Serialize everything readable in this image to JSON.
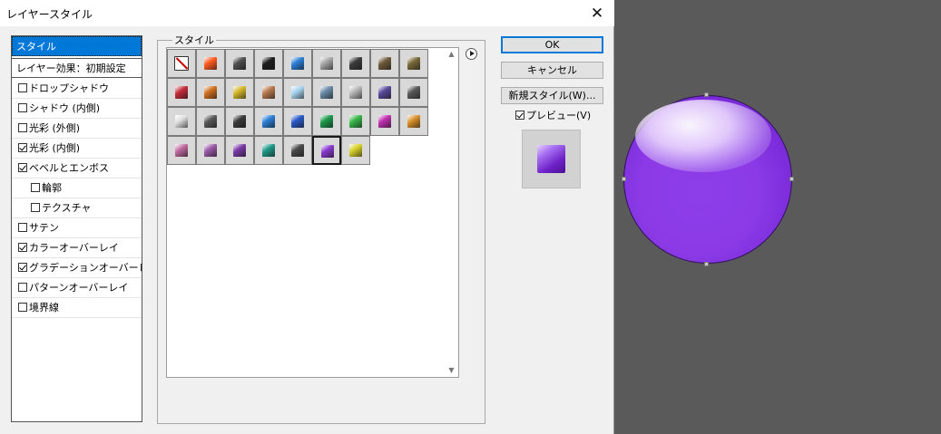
{
  "window": {
    "title": "レイヤースタイル",
    "close_symbol": "✕"
  },
  "sidebar": {
    "selected": "スタイル",
    "header": "レイヤー効果：初期設定",
    "items": [
      {
        "label": "ドロップシャドウ",
        "checked": false,
        "indent": false
      },
      {
        "label": "シャドウ (内側)",
        "checked": false,
        "indent": false
      },
      {
        "label": "光彩 (外側)",
        "checked": false,
        "indent": false
      },
      {
        "label": "光彩 (内側)",
        "checked": true,
        "indent": false
      },
      {
        "label": "ベベルとエンボス",
        "checked": true,
        "indent": false
      },
      {
        "label": "輪郭",
        "checked": false,
        "indent": true
      },
      {
        "label": "テクスチャ",
        "checked": false,
        "indent": true
      },
      {
        "label": "サテン",
        "checked": false,
        "indent": false
      },
      {
        "label": "カラーオーバーレイ",
        "checked": true,
        "indent": false
      },
      {
        "label": "グラデーションオーバーレイ",
        "checked": true,
        "indent": false
      },
      {
        "label": "パターンオーバーレイ",
        "checked": false,
        "indent": false
      },
      {
        "label": "境界線",
        "checked": false,
        "indent": false
      }
    ]
  },
  "styles": {
    "group_label": "スタイル",
    "swatches": [
      [
        "none",
        "#ff5a1e",
        "#505050",
        "#1e1e1e",
        "#2c7fd6",
        "#a8a8a8",
        "#3c3c3c",
        "#6e5a3c",
        "#7a6a3a"
      ],
      [
        "#c42b3a",
        "#d07020",
        "#d6b82a",
        "#b87a50",
        "#a8d4f0",
        "#6a8aa8",
        "#b8b8b8",
        "#5a4a9a",
        "#5a5a5a"
      ],
      [
        "#e0e0e0",
        "#5a5a5a",
        "#3a3a3a",
        "#2c7fd6",
        "#2a5ac8",
        "#1f9a4a",
        "#3ab84a",
        "#c030b0",
        "#d8902a"
      ],
      [
        "#c06aa0",
        "#9a5aa8",
        "#7a3aa8",
        "#1f9a8a",
        "#4a4a4a",
        "#8a3ad0",
        "#d8d02a"
      ]
    ],
    "selected": {
      "row": 3,
      "col": 5
    }
  },
  "buttons": {
    "ok": "OK",
    "cancel": "キャンセル",
    "new_style": "新規スタイル(W)..."
  },
  "preview": {
    "label": "プレビュー(V)",
    "checked": true
  }
}
